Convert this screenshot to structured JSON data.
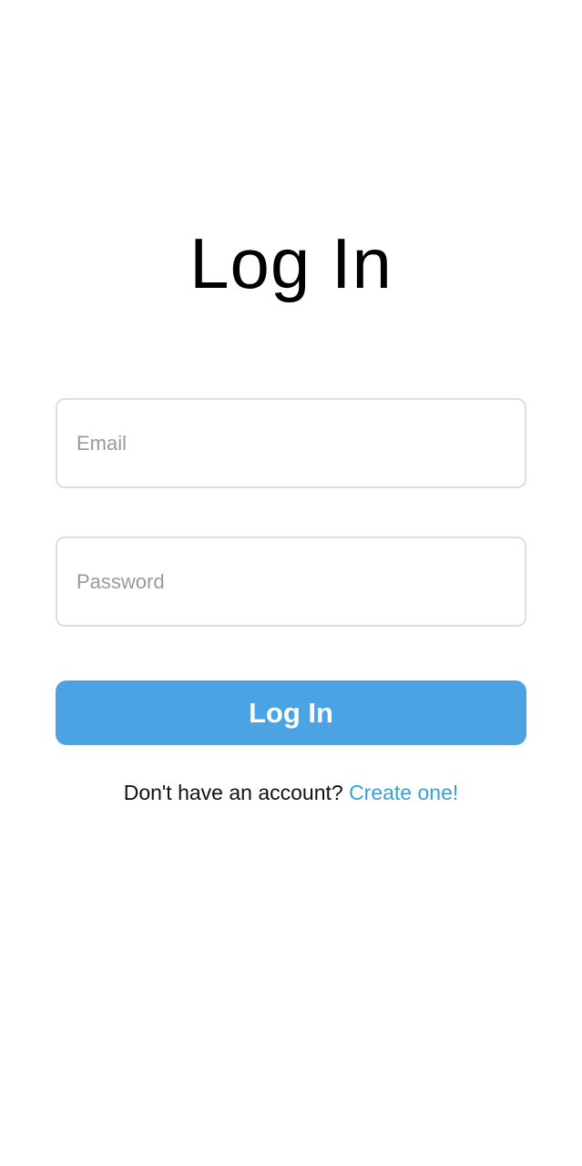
{
  "page": {
    "title": "Log In"
  },
  "form": {
    "email_placeholder": "Email",
    "email_value": "",
    "password_placeholder": "Password",
    "password_value": "",
    "submit_label": "Log In"
  },
  "signup": {
    "prompt": "Don't have an account?",
    "link_label": "Create one!"
  },
  "colors": {
    "background": "#ffffff",
    "primary_button": "#4ba3e3",
    "link": "#3a9fd8",
    "input_border": "#dedede",
    "placeholder": "#9a9a9a"
  }
}
